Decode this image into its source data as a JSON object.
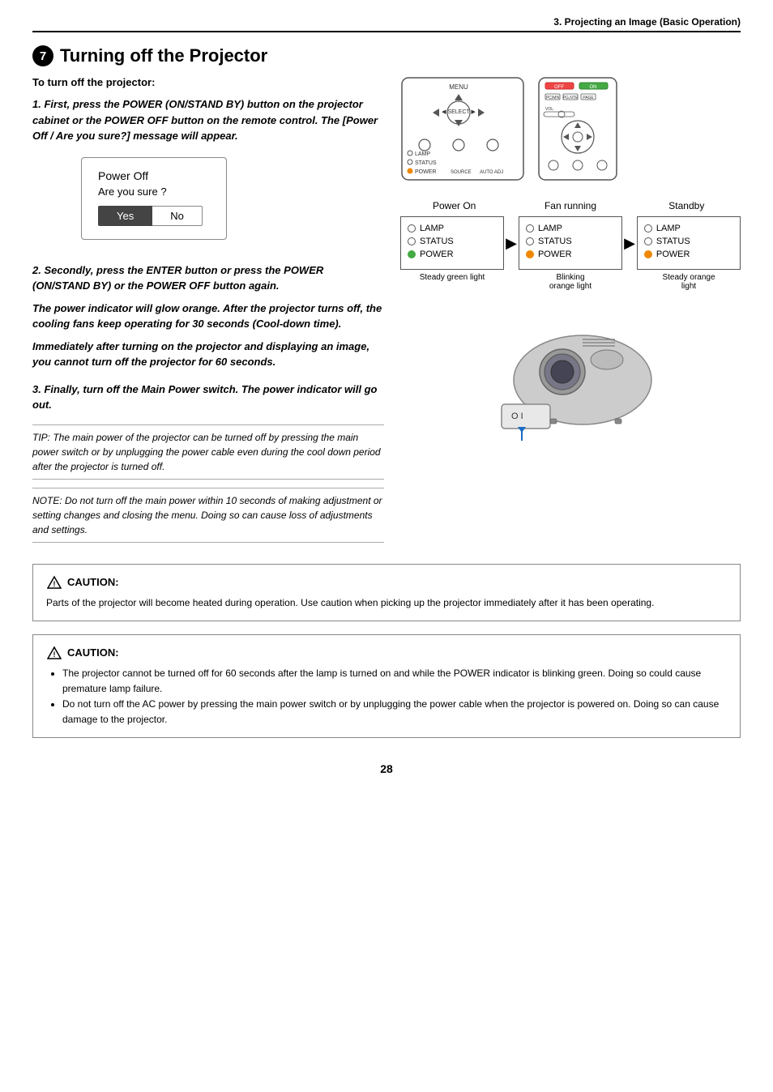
{
  "header": {
    "text": "3. Projecting an Image (Basic Operation)"
  },
  "section": {
    "number": "7",
    "title": "Turning off the Projector",
    "subtitle": "To turn off the projector:"
  },
  "steps": {
    "step1": {
      "number": "1.",
      "text": "First, press the POWER (ON/STAND BY) button on the projector cabinet or the POWER OFF button on the remote control. The [Power Off / Are you sure?] message will appear."
    },
    "step2": {
      "number": "2.",
      "text": "Secondly, press the ENTER button or press the POWER (ON/STAND BY) or the POWER OFF button again."
    },
    "step2_note1": "The power indicator will glow orange. After the projector turns off, the cooling fans keep operating for 30 seconds (Cool-down time).",
    "step2_note2": "Immediately after turning on the projector and displaying an image, you cannot turn off the projector for 60 seconds.",
    "step3": {
      "number": "3.",
      "text": "Finally, turn off the Main Power switch. The power indicator will go out."
    }
  },
  "power_off_dialog": {
    "title": "Power Off",
    "subtitle": "Are you sure ?",
    "yes_label": "Yes",
    "no_label": "No"
  },
  "tip": {
    "text": "TIP: The main power of the projector can be turned off by pressing the main power switch or by unplugging the power cable even during the cool down period after the projector is turned off."
  },
  "note": {
    "text": "NOTE: Do not turn off the main power within 10 seconds of making adjustment or setting changes and closing the menu. Doing so can cause loss of adjustments and settings."
  },
  "indicators": {
    "labels": [
      "Power On",
      "Fan running",
      "Standby"
    ],
    "rows": [
      {
        "label": "LAMP",
        "power_on": "empty",
        "fan": "empty",
        "standby": "empty"
      },
      {
        "label": "STATUS",
        "power_on": "empty",
        "fan": "empty",
        "standby": "empty"
      },
      {
        "label": "POWER",
        "power_on": "green",
        "fan": "orange",
        "standby": "orange"
      }
    ],
    "sublabels": [
      "Steady green light",
      "Blinking\norange light",
      "Steady orange\nlight"
    ]
  },
  "caution1": {
    "title": "CAUTION:",
    "text": "Parts of the projector will become heated during operation. Use caution when picking up the projector immediately after it has been operating."
  },
  "caution2": {
    "title": "CAUTION:",
    "bullets": [
      "The projector cannot be turned off for 60 seconds after the lamp is turned on and while the POWER indicator is blinking green. Doing so could cause premature lamp failure.",
      "Do not turn off the AC power by pressing the main power switch or by unplugging the power cable when the projector is powered on. Doing so can cause damage to the projector."
    ]
  },
  "page_number": "28"
}
